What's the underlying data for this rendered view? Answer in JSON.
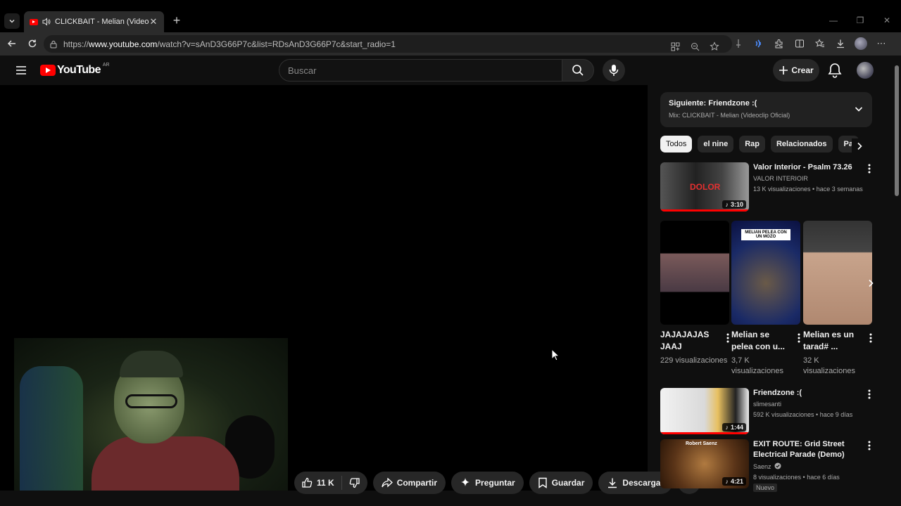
{
  "browser": {
    "tab_title": "CLICKBAIT - Melian (Videoclip",
    "url_prefix": "https://",
    "url_host": "www.youtube.com",
    "url_path": "/watch?v=sAnD3G66P7c&list=RDsAnD3G66P7c&start_radio=1"
  },
  "header": {
    "logo_text": "YouTube",
    "country_code": "AR",
    "search_placeholder": "Buscar",
    "create_label": "Crear"
  },
  "actions": {
    "like_count": "11 K",
    "share": "Compartir",
    "ask": "Preguntar",
    "save": "Guardar",
    "download": "Descargar"
  },
  "up_next": {
    "title": "Siguiente: Friendzone :(",
    "subtitle": "Mix: CLICKBAIT - Melian (Videoclip Oficial)"
  },
  "chips": [
    "Todos",
    "el nine",
    "Rap",
    "Relacionados",
    "Pa"
  ],
  "videos": [
    {
      "title": "Valor Interior - Psalm 73.26",
      "channel": "VALOR INTERIOIR",
      "meta": "13 K visualizaciones • hace 3 semanas",
      "duration": "3:10",
      "thumb_text": "DOLOR"
    },
    {
      "title": "Friendzone :(",
      "channel": "slimesanti",
      "meta": "592 K visualizaciones • hace 9 días",
      "duration": "1:44"
    },
    {
      "title": "EXIT ROUTE: Grid Street Electrical Parade (Demo)",
      "channel": "Saenz",
      "meta": "8 visualizaciones • hace 6 días",
      "duration": "4:21",
      "badge": "Nuevo",
      "thumb_text": "Robert Saenz"
    }
  ],
  "shorts": [
    {
      "title": "JAJAJAJAS JAAJ",
      "views": "229 visualizaciones"
    },
    {
      "title": "Melian se pelea con u...",
      "views": "3,7 K visualizaciones",
      "thumb_text": "MELIAN PELEA CON UN MOZO"
    },
    {
      "title": "Melian es un tarad# ...",
      "views": "32 K visualizaciones"
    }
  ],
  "colors": {
    "accent": "#ff0000",
    "bg": "#0f0f0f",
    "surface": "#272727"
  }
}
